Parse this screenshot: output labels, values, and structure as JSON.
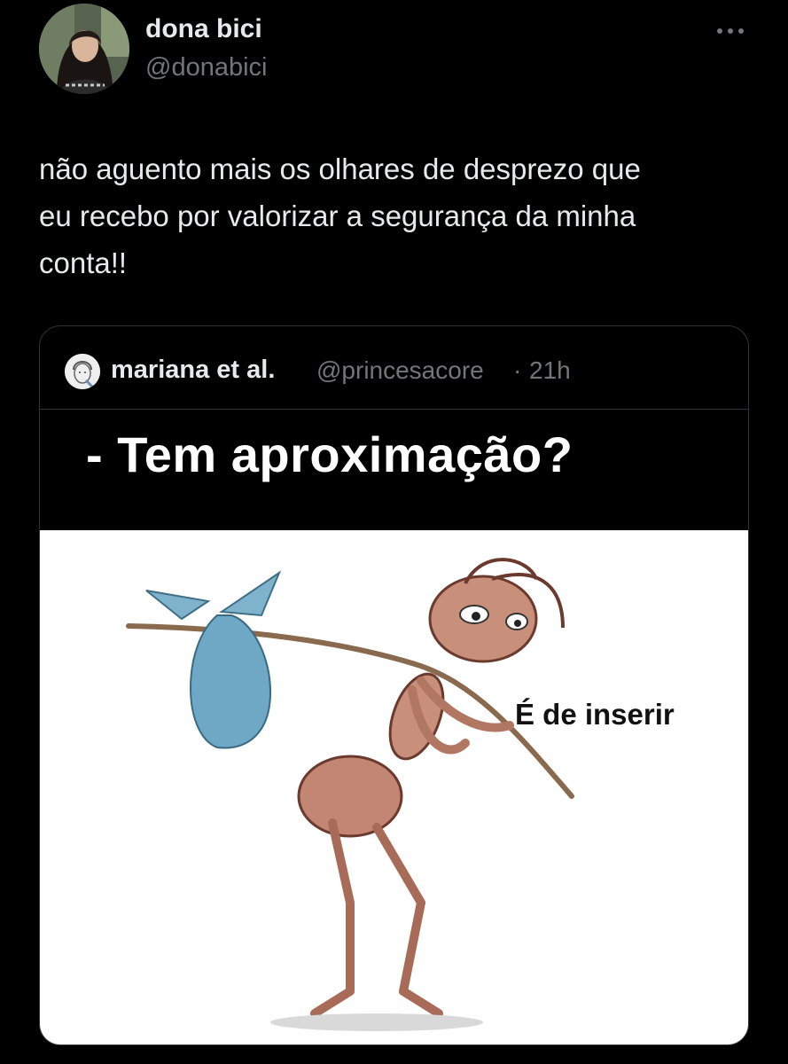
{
  "author": {
    "display_name": "dona bici",
    "handle": "@donabici",
    "avatar_icon": "profile-photo"
  },
  "more_icon": "more-options-icon",
  "tweet": {
    "text_lines": [
      "não aguento mais os olhares de desprezo que",
      "eu recebo por valorizar a segurança da minha",
      "conta!!"
    ]
  },
  "quoted": {
    "display_name": "mariana et al.",
    "handle": "@princesacore",
    "separator": "·",
    "time": "21h",
    "avatar_icon": "profile-drawing",
    "meme": {
      "caption": "- Tem aproximação?",
      "label": "É de inserir",
      "illustration": "ant-with-bindle"
    }
  },
  "colors": {
    "background": "#000000",
    "primary_text": "#e7e9ea",
    "secondary_text": "#71767b",
    "border": "#2f3336"
  }
}
